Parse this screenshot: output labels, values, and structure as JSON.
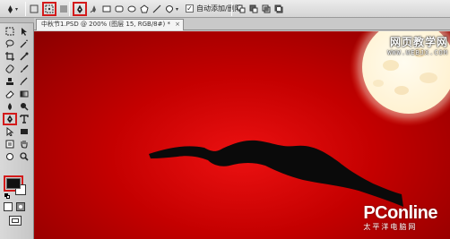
{
  "options_bar": {
    "auto_add_delete_label": "自动添加/删除",
    "auto_add_delete_checked": true,
    "check_mark": "✓"
  },
  "document": {
    "tab_title": "中秋节1.PSD @ 200% (图层 15, RGB/8#) *",
    "close_glyph": "×"
  },
  "watermarks": {
    "top_big": "网页教学网",
    "top_small": "WWW.WEBJX.COM",
    "bottom_brand": "PConline",
    "bottom_sub": "太平洋电脑网"
  },
  "colors": {
    "canvas_red": "#d80000",
    "moon": "#fff6dc",
    "silhouette": "#0a0a0a",
    "highlight_outline": "#d31b1b",
    "foreground_color": "#111111",
    "background_color": "#ffffff"
  },
  "icons": {
    "active_tool": "pen-icon"
  }
}
